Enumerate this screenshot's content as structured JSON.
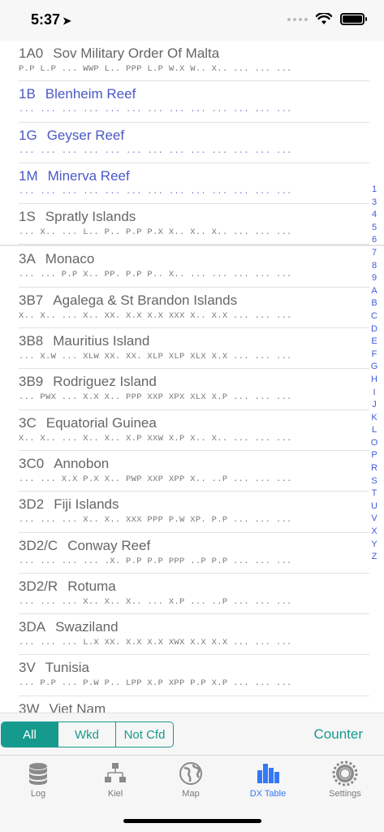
{
  "status": {
    "time": "5:37"
  },
  "rows_a": [
    {
      "prefix": "1A0",
      "name": "Sov Military Order Of Malta",
      "pattern": "P.P L.P ... WWP L.. PPP L.P W.X W.. X.. ... ... ...",
      "blue": false
    },
    {
      "prefix": "1B",
      "name": "Blenheim Reef",
      "pattern": "... ... ... ... ... ... ... ... ... ... ... ... ...",
      "blue": true
    },
    {
      "prefix": "1G",
      "name": "Geyser Reef",
      "pattern": "... ... ... ... ... ... ... ... ... ... ... ... ...",
      "blue": true
    },
    {
      "prefix": "1M",
      "name": "Minerva Reef",
      "pattern": "... ... ... ... ... ... ... ... ... ... ... ... ...",
      "blue": true
    },
    {
      "prefix": "1S",
      "name": "Spratly Islands",
      "pattern": "... X.. ... L.. P.. P.P P.X X.. X.. X.. ... ... ...",
      "blue": false
    }
  ],
  "rows_b": [
    {
      "prefix": "3A",
      "name": "Monaco",
      "pattern": "... ... P.P X.. PP. P.P P.. X.. ... ... ... ... ...",
      "blue": false
    },
    {
      "prefix": "3B7",
      "name": "Agalega & St Brandon Islands",
      "pattern": "X.. X.. ... X.. XX. X.X X.X XXX X.. X.X ... ... ...",
      "blue": false
    },
    {
      "prefix": "3B8",
      "name": "Mauritius Island",
      "pattern": "... X.W ... XLW XX. XX. XLP XLP XLX X.X ... ... ...",
      "blue": false
    },
    {
      "prefix": "3B9",
      "name": "Rodriguez Island",
      "pattern": "... PWX ... X.X X.. PPP XXP XPX XLX X.P ... ... ...",
      "blue": false
    },
    {
      "prefix": "3C",
      "name": "Equatorial Guinea",
      "pattern": "X.. X.. ... X.. X.. X.P XXW X.P X.. X.. ... ... ...",
      "blue": false
    },
    {
      "prefix": "3C0",
      "name": "Annobon",
      "pattern": "... ... X.X P.X X.. PWP XXP XPP X.. ..P ... ... ...",
      "blue": false
    },
    {
      "prefix": "3D2",
      "name": "Fiji Islands",
      "pattern": "... ... ... X.. X.. XXX PPP P.W XP. P.P ... ... ...",
      "blue": false
    },
    {
      "prefix": "3D2/C",
      "name": "Conway Reef",
      "pattern": "... ... ... ... .X. P.P P.P PPP ..P P.P ... ... ...",
      "blue": false
    },
    {
      "prefix": "3D2/R",
      "name": "Rotuma",
      "pattern": "... ... ... X.. X.. X.. ... X.P ... ..P ... ... ...",
      "blue": false
    },
    {
      "prefix": "3DA",
      "name": "Swaziland",
      "pattern": "... ... ... L.X XX. X.X X.X XWX X.X X.X ... ... ...",
      "blue": false
    },
    {
      "prefix": "3V",
      "name": "Tunisia",
      "pattern": "... P.P ... P.W P.. LPP X.P XPP P.P X.P ... ... ...",
      "blue": false
    },
    {
      "prefix": "3W",
      "name": "Viet Nam",
      "pattern": "",
      "blue": false
    }
  ],
  "index_letters": [
    "1",
    "3",
    "4",
    "5",
    "6",
    "7",
    "8",
    "9",
    "A",
    "B",
    "C",
    "D",
    "E",
    "F",
    "G",
    "H",
    "I",
    "J",
    "K",
    "L",
    "O",
    "P",
    "R",
    "S",
    "T",
    "U",
    "V",
    "X",
    "Y",
    "Z"
  ],
  "filter": {
    "segments": [
      "All",
      "Wkd",
      "Not Cfd"
    ],
    "active": 0,
    "counter_label": "Counter"
  },
  "tabs": [
    {
      "label": "Log",
      "icon": "database-icon"
    },
    {
      "label": "Kiel",
      "icon": "hierarchy-icon"
    },
    {
      "label": "Map",
      "icon": "globe-icon"
    },
    {
      "label": "DX Table",
      "icon": "bar-chart-icon"
    },
    {
      "label": "Settings",
      "icon": "gear-icon"
    }
  ],
  "active_tab": 3,
  "colors": {
    "accent": "#179a8e",
    "link_blue": "#4a58c6",
    "tab_active": "#3478f6"
  }
}
